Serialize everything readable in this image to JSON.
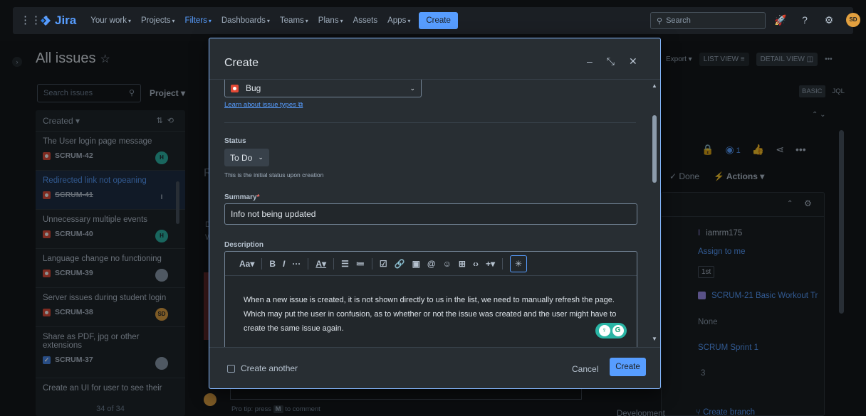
{
  "topnav": {
    "logo": "Jira",
    "items": [
      {
        "label": "Your work",
        "active": false
      },
      {
        "label": "Projects",
        "active": false
      },
      {
        "label": "Filters",
        "active": true
      },
      {
        "label": "Dashboards",
        "active": false
      },
      {
        "label": "Teams",
        "active": false
      },
      {
        "label": "Plans",
        "active": false
      },
      {
        "label": "Assets",
        "active": false
      },
      {
        "label": "Apps",
        "active": false
      }
    ],
    "create_label": "Create",
    "search_placeholder": "Search",
    "avatar_initials": "SD"
  },
  "page": {
    "title": "All issues",
    "search_placeholder": "Search issues",
    "project_filter": "Project",
    "list_header": "Created",
    "issues": [
      {
        "title": "The User login page message",
        "key": "SCRUM-42",
        "type": "bug",
        "assignee": "H",
        "assignee_style": "teal",
        "strike": false,
        "selected": false
      },
      {
        "title": "Redirected link not opeaning",
        "key": "SCRUM-41",
        "type": "bug",
        "assignee": "I",
        "assignee_style": "letter",
        "strike": true,
        "selected": true
      },
      {
        "title": "Unnecessary multiple events",
        "key": "SCRUM-40",
        "type": "bug",
        "assignee": "H",
        "assignee_style": "teal",
        "strike": false,
        "selected": false
      },
      {
        "title": "Language change no functioning",
        "key": "SCRUM-39",
        "type": "bug",
        "assignee": "",
        "assignee_style": "gray",
        "strike": false,
        "selected": false
      },
      {
        "title": "Server issues during student login",
        "key": "SCRUM-38",
        "type": "bug",
        "assignee": "SD",
        "assignee_style": "orange",
        "strike": false,
        "selected": false
      }
    ],
    "issue6": {
      "title1": "Share as PDF, jpg or other",
      "title2": "extensions",
      "key": "SCRUM-37"
    },
    "issue7_title": "Create an UI for user to see their",
    "list_count": "34 of 34",
    "pro_tip_prefix": "Pro tip:",
    "pro_tip_press": "press",
    "pro_tip_key": "M",
    "pro_tip_suffix": "to comment"
  },
  "right": {
    "export_label": "Export",
    "list_view": "LIST VIEW",
    "detail_view": "DETAIL VIEW",
    "basic": "BASIC",
    "jql": "JQL",
    "watch_count": "1",
    "done_label": "Done",
    "actions_label": "Actions",
    "assignee_letter": "I",
    "assignee_name": "iamrm175",
    "assign_to_me": "Assign to me",
    "priority_chip": "1st",
    "epic": "SCRUM-21 Basic Workout Tr",
    "none_label": "None",
    "sprint": "SCRUM Sprint 1",
    "points": "3",
    "development": "Development",
    "create_branch": "Create branch"
  },
  "modal": {
    "title": "Create",
    "issue_type": "Bug",
    "learn_link": "Learn about issue types",
    "status_label": "Status",
    "status_value": "To Do",
    "status_helper": "This is the initial status upon creation",
    "summary_label": "Summary",
    "summary_required": "*",
    "summary_value": "Info not being updated",
    "description_label": "Description",
    "text_style": "Aa",
    "description_text": "When a new issue is created, it is not shown directly to us in the list, we need to manually refresh the page. Which may put the user in confusion, as to whether or not the issue was created and the user might have to create the same issue again.",
    "create_another": "Create another",
    "cancel": "Cancel",
    "create": "Create"
  },
  "colors": {
    "accent": "#579dff",
    "bug": "#e34935",
    "modal_border": "#85b8ff"
  }
}
